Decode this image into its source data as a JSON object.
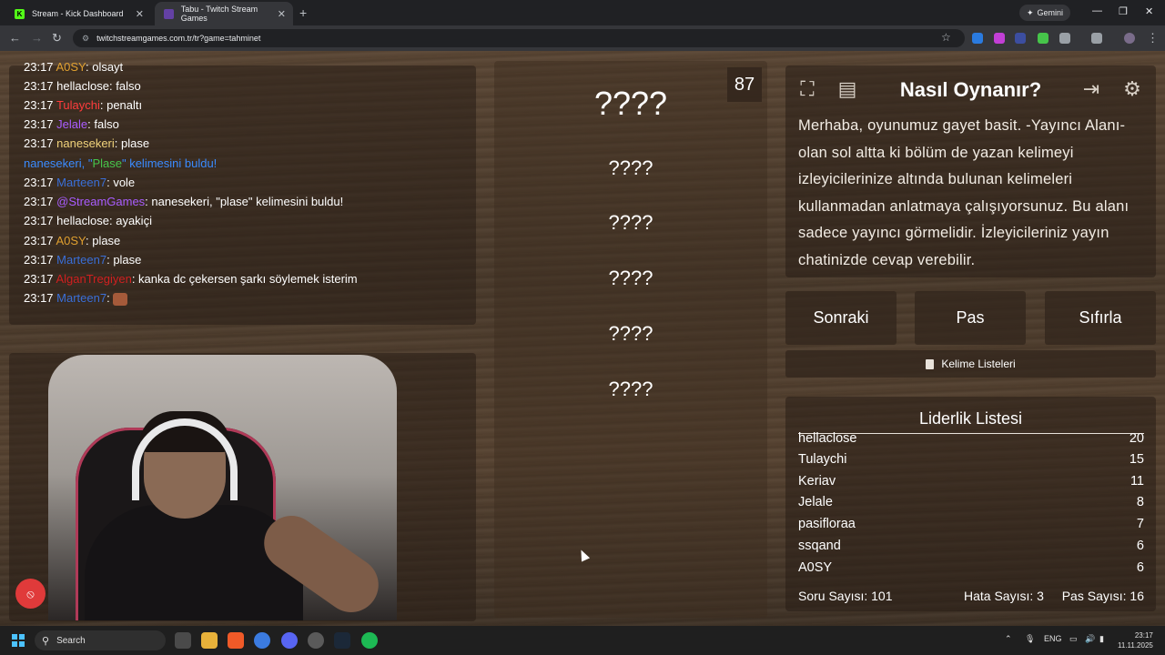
{
  "browser": {
    "tabs": [
      {
        "title": "Stream - Kick Dashboard",
        "favicon": "K",
        "active": false
      },
      {
        "title": "Tabu - Twitch Stream Games",
        "favicon": "",
        "active": true
      }
    ],
    "gemini_label": "Gemini",
    "url": "twitchstreamgames.com.tr/tr?game=tahminet"
  },
  "chat": {
    "lines": [
      {
        "time": "23:17",
        "user": "A0SY",
        "user_color": "#e0a030",
        "msg": ": olsayt"
      },
      {
        "time": "23:17",
        "user": "hellaclose",
        "user_color": "#ffffff",
        "msg": ": falso"
      },
      {
        "time": "23:17",
        "user": "Tulaychi",
        "user_color": "#ff3b3b",
        "msg": ": penaltı"
      },
      {
        "time": "23:17",
        "user": "Jelale",
        "user_color": "#a95cff",
        "msg": ": falso"
      },
      {
        "time": "23:17",
        "user": "nanesekeri",
        "user_color": "#f0d27a",
        "msg": ": plase"
      },
      {
        "time": "",
        "user": "nanesekeri, \"",
        "user_color": "#3a8bff",
        "msg": "\" kelimesini buldu!",
        "highlight": "Plase"
      },
      {
        "time": "23:17",
        "user": "Marteen7",
        "user_color": "#3a6fd8",
        "msg": ": vole"
      },
      {
        "time": "23:17",
        "user": "@StreamGames",
        "user_color": "#a95cff",
        "msg": ": nanesekeri, \"plase\" kelimesini buldu!"
      },
      {
        "time": "23:17",
        "user": "hellaclose",
        "user_color": "#ffffff",
        "msg": ": ayakiçi"
      },
      {
        "time": "23:17",
        "user": "A0SY",
        "user_color": "#e0a030",
        "msg": ": plase"
      },
      {
        "time": "23:17",
        "user": "Marteen7",
        "user_color": "#3a6fd8",
        "msg": ": plase"
      },
      {
        "time": "23:17",
        "user": "AlganTregiyen",
        "user_color": "#d02020",
        "msg": ": kanka dc çekersen şarkı söylemek isterim"
      },
      {
        "time": "23:17",
        "user": "Marteen7",
        "user_color": "#3a6fd8",
        "msg": ": ",
        "emote": true
      }
    ]
  },
  "words": {
    "main": "????",
    "others": [
      "????",
      "????",
      "????",
      "????",
      "????"
    ],
    "counter": "87"
  },
  "howto": {
    "title": "Nasıl Oynanır?",
    "text": "Merhaba, oyunumuz gayet basit. -Yayıncı Alanı- olan sol altta ki bölüm de yazan kelimeyi izleyicilerinize altında bulunan kelimeleri kullanmadan anlatmaya çalışıyorsunuz. Bu alanı sadece yayıncı görmelidir. İzleyicileriniz yayın chatinizde cevap verebilir."
  },
  "buttons": {
    "next": "Sonraki",
    "pass": "Pas",
    "reset": "Sıfırla",
    "word_lists": "Kelime Listeleri"
  },
  "leaderboard": {
    "title": "Liderlik Listesi",
    "rows": [
      {
        "name": "hellaclose",
        "score": "20"
      },
      {
        "name": "Tulaychi",
        "score": "15"
      },
      {
        "name": "Keriav",
        "score": "11"
      },
      {
        "name": "Jelale",
        "score": "8"
      },
      {
        "name": "pasifloraa",
        "score": "7"
      },
      {
        "name": "ssqand",
        "score": "6"
      },
      {
        "name": "A0SY",
        "score": "6"
      }
    ],
    "stats": {
      "questions": "Soru Sayısı: 101",
      "errors": "Hata Sayısı: 3",
      "passes": "Pas Sayısı: 16"
    }
  },
  "taskbar": {
    "search_label": "Search",
    "lang": "ENG",
    "time": "23:17",
    "date": "11.11.2025"
  }
}
